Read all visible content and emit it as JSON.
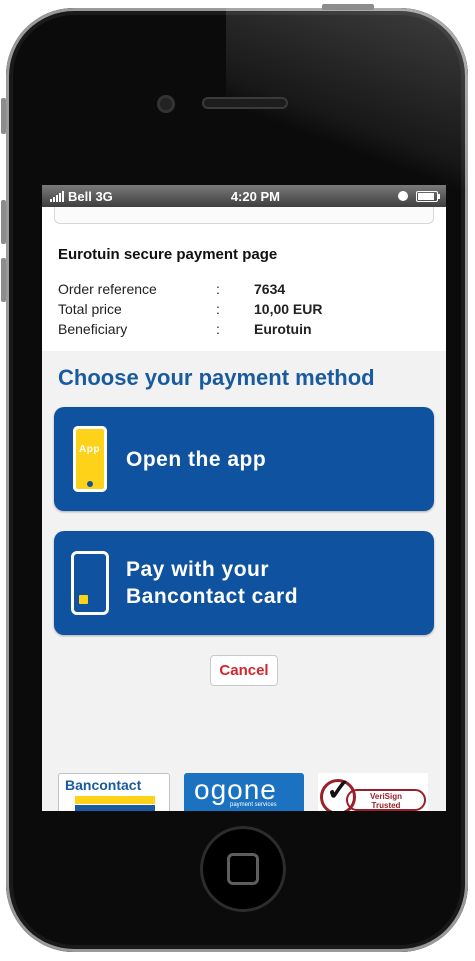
{
  "statusbar": {
    "carrier": "Bell 3G",
    "time": "4:20 PM"
  },
  "page": {
    "title": "Eurotuin secure payment page",
    "details": [
      {
        "label": "Order reference",
        "colon": ":",
        "value": "7634"
      },
      {
        "label": "Total price",
        "colon": ":",
        "value": "10,00 EUR"
      },
      {
        "label": "Beneficiary",
        "colon": ":",
        "value": "Eurotuin"
      }
    ]
  },
  "payment": {
    "heading": "Choose your payment method",
    "open_app": {
      "label": "Open the app",
      "icon_text": "App"
    },
    "pay_card": {
      "line1": "Pay with your",
      "line2": "Bancontact card"
    },
    "cancel": "Cancel"
  },
  "logos": {
    "bancontact": "Bancontact",
    "ogone": "ogone",
    "ogone_sub": "payment services",
    "verisign_line1": "VeriSign",
    "verisign_line2": "Trusted"
  },
  "colors": {
    "primary": "#0f53a0",
    "heading": "#1a5b9f",
    "accent": "#ffd21a",
    "cancel": "#d3262e"
  }
}
